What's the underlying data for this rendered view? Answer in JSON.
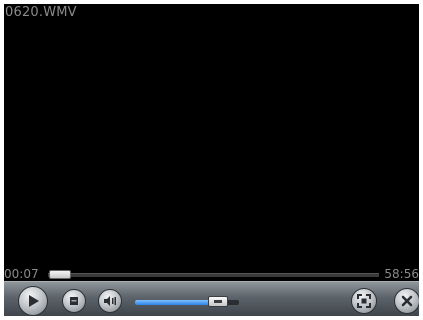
{
  "video": {
    "file_name": "0620.WMV"
  },
  "seek": {
    "elapsed": "00:07",
    "total": "58:56",
    "progress": 0.002
  },
  "controls": {
    "volume_level": 0.8,
    "icons": {
      "play": "play-icon",
      "stop": "stop-icon",
      "volume": "speaker-icon",
      "fullscreen": "fullscreen-icon",
      "close": "close-icon"
    }
  },
  "colors": {
    "background": "#000000",
    "text": "#8a8a8a",
    "volume_fill": "#2d84e8",
    "control_bar": "#5c636a"
  }
}
